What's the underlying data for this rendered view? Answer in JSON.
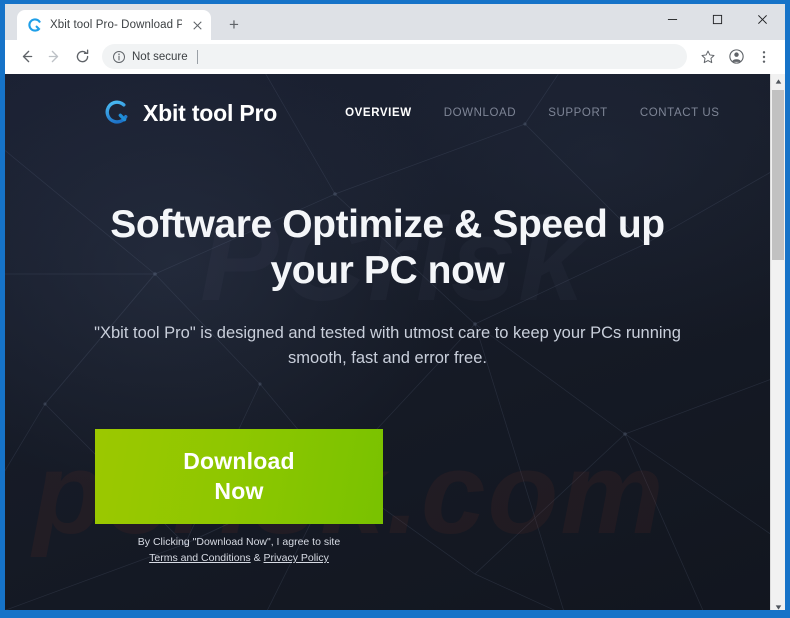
{
  "browser": {
    "tab": {
      "title": "Xbit tool Pro- Download PC Clea",
      "favicon_icon": "xbit-q-logo-icon",
      "close_icon": "close-icon"
    },
    "new_tab_label": "+",
    "window_controls": {
      "minimize_icon": "minimize-icon",
      "maximize_icon": "maximize-icon",
      "close_icon": "close-window-icon"
    },
    "toolbar": {
      "back_icon": "back-arrow-icon",
      "forward_icon": "forward-arrow-icon",
      "reload_icon": "reload-icon",
      "security_icon": "info-circle-icon",
      "security_label": "Not secure",
      "address_value": "",
      "address_placeholder": "",
      "bookmark_icon": "star-icon",
      "profile_icon": "profile-avatar-icon",
      "menu_icon": "three-dot-menu-icon"
    },
    "scrollbar": {
      "up_icon": "scroll-up-arrow-icon",
      "down_icon": "scroll-down-arrow-icon"
    }
  },
  "site": {
    "brand": {
      "logo_icon": "xbit-ring-logo-icon",
      "name": "Xbit tool Pro",
      "logo_color": "#1f9fe8"
    },
    "nav": [
      {
        "label": "OVERVIEW",
        "active": true
      },
      {
        "label": "DOWNLOAD",
        "active": false
      },
      {
        "label": "SUPPORT",
        "active": false
      },
      {
        "label": "CONTACT US",
        "active": false
      }
    ],
    "hero": {
      "headline_line1": "Software Optimize & Speed up",
      "headline_line2": "your PC now",
      "subtext": "\"Xbit tool Pro\" is designed and tested with utmost care to keep your PCs running smooth, fast and error free."
    },
    "cta": {
      "button_line1": "Download",
      "button_line2": "Now",
      "button_color_left": "#9cc800",
      "button_color_right": "#79c200",
      "note_prefix": "By Clicking \"Download Now\", I agree to site",
      "terms_label": "Terms and Conditions",
      "note_separator": "&",
      "privacy_label": "Privacy Policy"
    },
    "watermark_dark": "PCrisk",
    "watermark_red": "pcrisk.com",
    "background_color": "#171c29",
    "frame_color": "#1673c8"
  }
}
